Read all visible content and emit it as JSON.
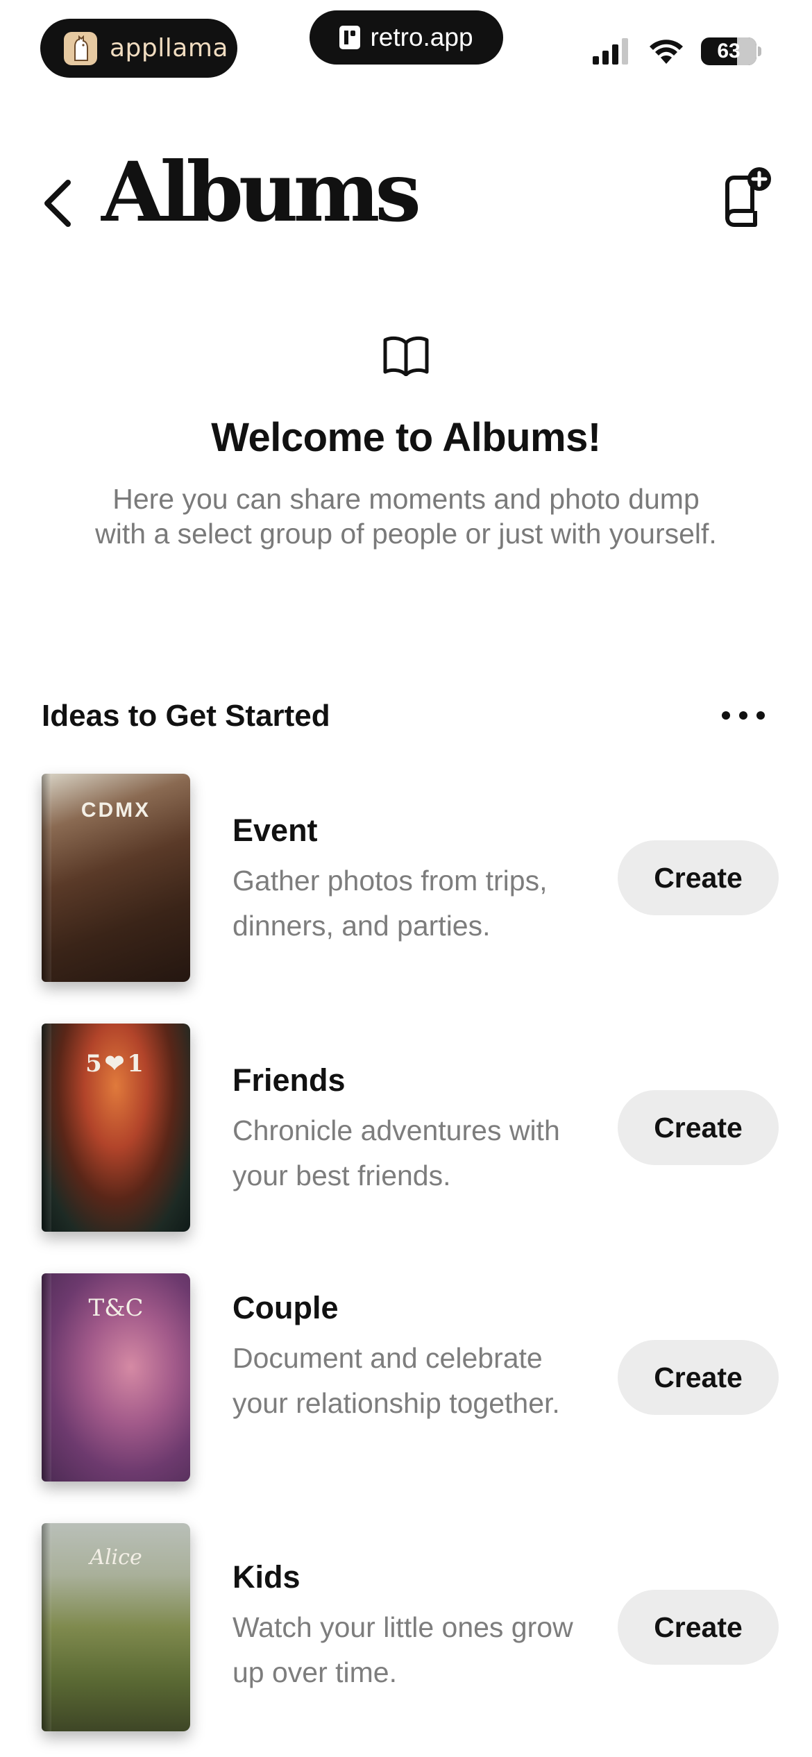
{
  "status_bar": {
    "left_app": "appllama",
    "center_app": "retro.app",
    "battery": "63"
  },
  "header": {
    "title": "Albums"
  },
  "welcome": {
    "title": "Welcome to Albums!",
    "body": "Here you can share moments and photo dump with a select group of people or just with yourself."
  },
  "ideas": {
    "title": "Ideas to Get Started",
    "items": [
      {
        "name": "Event",
        "description": "Gather photos from trips, dinners, and parties.",
        "cover_text": "CDMX",
        "button": "Create"
      },
      {
        "name": "Friends",
        "description": "Chronicle adventures with your best friends.",
        "cover_text": "5❤1",
        "button": "Create"
      },
      {
        "name": "Couple",
        "description": "Document and celebrate your relationship together.",
        "cover_text": "T&C",
        "button": "Create"
      },
      {
        "name": "Kids",
        "description": "Watch your little ones grow up over time.",
        "cover_text": "Alice",
        "button": "Create"
      }
    ]
  }
}
